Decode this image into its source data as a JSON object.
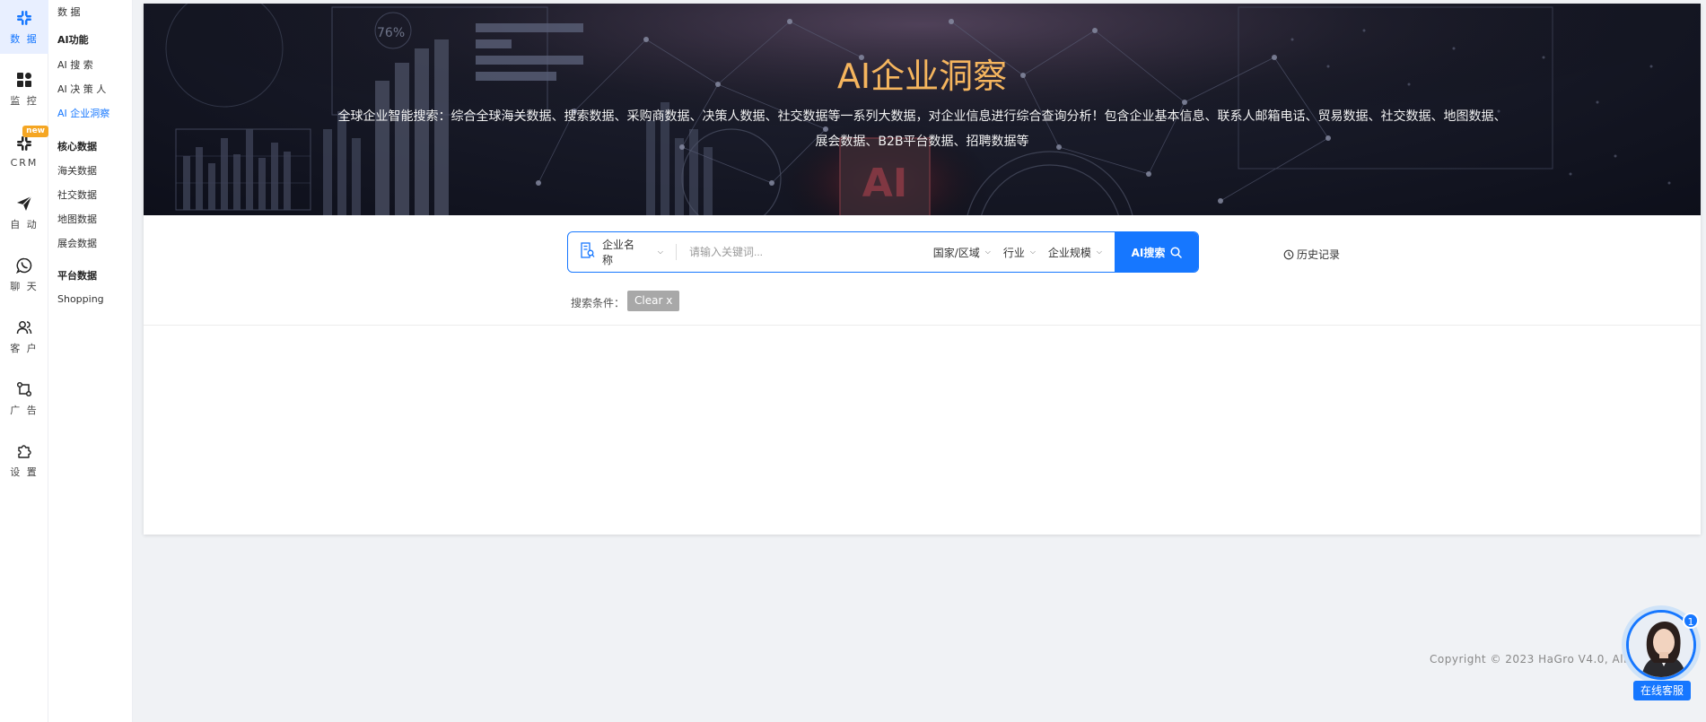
{
  "rail": {
    "items": [
      {
        "label": "数 据",
        "icon": "grid-hash-icon"
      },
      {
        "label": "监 控",
        "icon": "dashboard-icon"
      },
      {
        "label": "CRM",
        "icon": "crm-icon",
        "badge": "new"
      },
      {
        "label": "自 动",
        "icon": "paper-plane-icon"
      },
      {
        "label": "聊 天",
        "icon": "whatsapp-icon"
      },
      {
        "label": "客 户",
        "icon": "users-icon"
      },
      {
        "label": "广 告",
        "icon": "flow-icon"
      },
      {
        "label": "设 置",
        "icon": "puzzle-icon"
      }
    ]
  },
  "submenu": {
    "top_item": "数 据",
    "ai_group": "AI功能",
    "ai_items": [
      "AI 搜 索",
      "AI 决 策 人",
      "AI 企业洞察"
    ],
    "core_group": "核心数据",
    "core_items": [
      "海关数据",
      "社交数据",
      "地图数据",
      "展会数据"
    ],
    "platform_group": "平台数据",
    "platform_items": [
      "Shopping"
    ]
  },
  "hero": {
    "title": "AI企业洞察",
    "description_line1": "全球企业智能搜索：综合全球海关数据、搜索数据、采购商数据、决策人数据、社交数据等一系列大数据，对企业信息进行综合查询分析！包含企业基本信息、联系人邮箱电话、贸易数据、社交数据、地图数据、",
    "description_line2": "展会数据、B2B平台数据、招聘数据等",
    "decor_percent": "76%",
    "decor_ai": "AI"
  },
  "search": {
    "type_selector": "企业名称",
    "placeholder": "请输入关键词...",
    "filters": [
      "国家/区域",
      "行业",
      "企业规模"
    ],
    "button_label": "AI搜索",
    "history_label": "历史记录",
    "conditions_label": "搜索条件：",
    "clear_label": "Clear x"
  },
  "footer": {
    "copyright": "Copyright © 2023 HaGro V4.0, All ri"
  },
  "service": {
    "label": "在线客服",
    "badge_count": "1"
  },
  "colors": {
    "accent": "#1677ff",
    "title_gold": "#f5b55e",
    "new_badge": "#f5a623"
  }
}
